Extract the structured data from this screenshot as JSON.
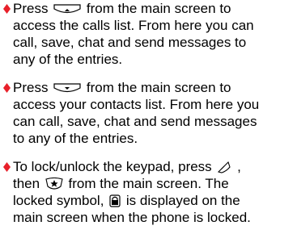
{
  "instructions": [
    {
      "lines": [
        {
          "before": "Press ",
          "icon": "up-softkey-icon",
          "after": " from the main screen to"
        },
        {
          "text": "access the calls list. From here you can"
        },
        {
          "text": "call, save, chat and send messages to"
        },
        {
          "text": "any of the entries."
        }
      ]
    },
    {
      "lines": [
        {
          "before": "Press ",
          "icon": "down-softkey-icon",
          "after": " from the main screen to"
        },
        {
          "text": "access your contacts list. From here you"
        },
        {
          "text": "can call, save, chat and send messages"
        },
        {
          "text": "to any of the entries."
        }
      ]
    },
    {
      "lines": [
        {
          "before": "To lock/unlock the keypad, press ",
          "icon": "left-softkey-icon",
          "after": ","
        },
        {
          "before": "then ",
          "icon": "star-key-icon",
          "after": " from the main screen. The"
        },
        {
          "before": "locked symbol, ",
          "icon": "lock-icon",
          "after": " is displayed on the"
        },
        {
          "text": "main screen when the phone is locked."
        }
      ]
    }
  ],
  "colors": {
    "bullet": "#e8202a",
    "text": "#000000"
  }
}
